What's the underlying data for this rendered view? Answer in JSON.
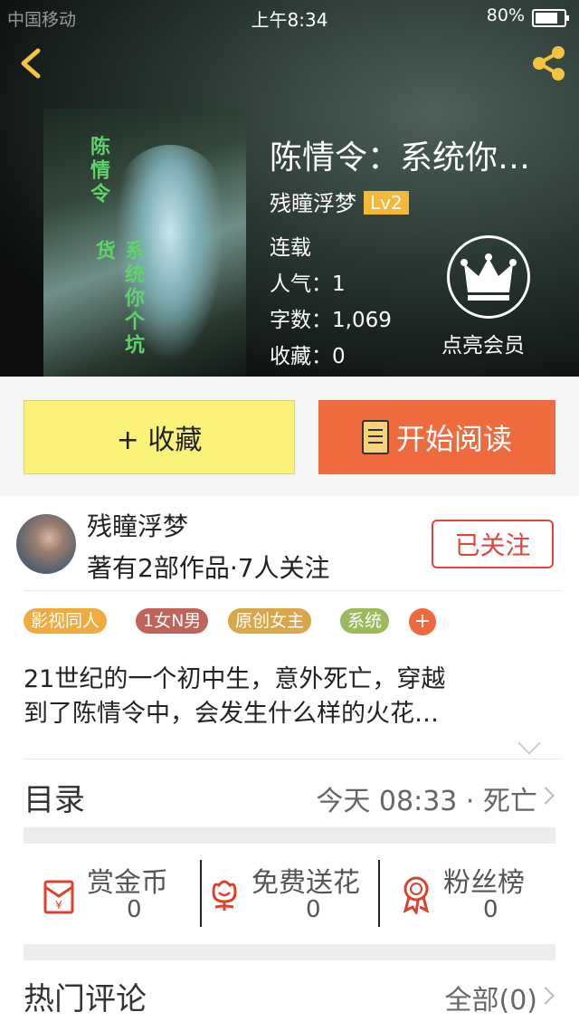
{
  "status_bar": {
    "carrier": "中国移动",
    "time": "上午8:34",
    "battery": "80%"
  },
  "book": {
    "title": "陈情令：系统你…",
    "author": "残瞳浮梦",
    "level": "Lv2",
    "status": "连载",
    "popularity": "人气：1",
    "word_count": "字数：1,069",
    "favorites": "收藏：0",
    "cover_text_1": "陈情令",
    "cover_text_2": "系统你个坑货"
  },
  "vip": {
    "label": "点亮会员"
  },
  "actions": {
    "collect": "+ 收藏",
    "read": "开始阅读"
  },
  "author_card": {
    "name": "残瞳浮梦",
    "stats": "著有2部作品·7人关注",
    "follow_label": "已关注"
  },
  "tags": [
    {
      "label": "影视同人",
      "color": "#f0ab3e"
    },
    {
      "label": "1女N男",
      "color": "#c0645a"
    },
    {
      "label": "原创女主",
      "color": "#d9a74a"
    },
    {
      "label": "系统",
      "color": "#9cba5b"
    }
  ],
  "tag_more": "+",
  "description": {
    "line1": "21世纪的一个初中生，意外死亡，穿越",
    "line2": "到了陈情令中，会发生什么样的火花…"
  },
  "catalog": {
    "label": "目录",
    "latest": "今天 08:33 · 死亡"
  },
  "rewards": [
    {
      "label": "赏金币",
      "count": "0",
      "icon": "red-envelope-icon"
    },
    {
      "label": "免费送花",
      "count": "0",
      "icon": "flower-icon"
    },
    {
      "label": "粉丝榜",
      "count": "0",
      "icon": "medal-icon"
    }
  ],
  "comments": {
    "label": "热门评论",
    "all": "全部(0)"
  },
  "colors": {
    "accent_orange": "#ef6a3d",
    "collect_yellow": "#fbf27a",
    "follow_red": "#e0473b",
    "level_badge": "#f5b839"
  }
}
